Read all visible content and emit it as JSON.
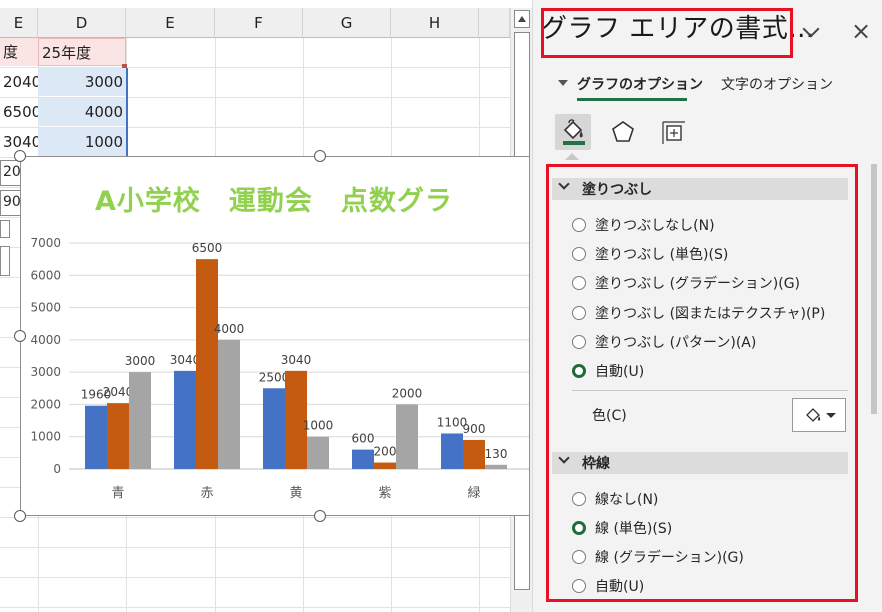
{
  "sheet": {
    "columns": [
      "E",
      "D",
      "E",
      "F",
      "G",
      "H"
    ],
    "rows": [
      {
        "c": "度",
        "d": "25年度"
      },
      {
        "c": "2040",
        "d": "3000"
      },
      {
        "c": "6500",
        "d": "4000"
      },
      {
        "c": "3040",
        "d": "1000"
      }
    ],
    "fragments": [
      "20",
      "90"
    ]
  },
  "chart_data": {
    "type": "bar",
    "title": "A小学校　運動会　点数グラ",
    "categories": [
      "青",
      "赤",
      "黄",
      "紫",
      "緑"
    ],
    "series": [
      {
        "values": [
          1960,
          3040,
          2500,
          600,
          1100
        ],
        "color": "#4472c4"
      },
      {
        "values": [
          2040,
          6500,
          3040,
          200,
          900
        ],
        "color": "#c55a11"
      },
      {
        "values": [
          3000,
          4000,
          1000,
          2000,
          130
        ],
        "color": "#a5a5a5"
      }
    ],
    "data_labels": [
      [
        "1960",
        "3040",
        "2500",
        "600",
        "1100"
      ],
      [
        "2040",
        "6500",
        "3040",
        "200",
        "900"
      ],
      [
        "3000",
        "4000",
        "1000",
        "2000",
        "130"
      ]
    ],
    "ylim": [
      0,
      7000
    ],
    "yticks": [
      "0",
      "1000",
      "2000",
      "3000",
      "4000",
      "5000",
      "6000",
      "7000"
    ],
    "grid": true,
    "title_color": "#92d050"
  },
  "pane": {
    "title": "グラフ エリアの書式…",
    "close_icon": "×",
    "tabs": [
      "グラフのオプション",
      "文字のオプション"
    ],
    "icons": [
      "fill-line-icon",
      "effects-icon",
      "size-properties-icon"
    ],
    "fill": {
      "header": "塗りつぶし",
      "options": [
        "塗りつぶしなし(N)",
        "塗りつぶし (単色)(S)",
        "塗りつぶし (グラデーション)(G)",
        "塗りつぶし (図またはテクスチャ)(P)",
        "塗りつぶし (パターン)(A)",
        "自動(U)"
      ],
      "selected_index": 5,
      "color_label": "色(C)"
    },
    "line": {
      "header": "枠線",
      "options": [
        "線なし(N)",
        "線 (単色)(S)",
        "線 (グラデーション)(G)",
        "自動(U)"
      ],
      "selected_index": 1
    },
    "highlight_color": "#e81123",
    "accent_color": "#217346"
  }
}
